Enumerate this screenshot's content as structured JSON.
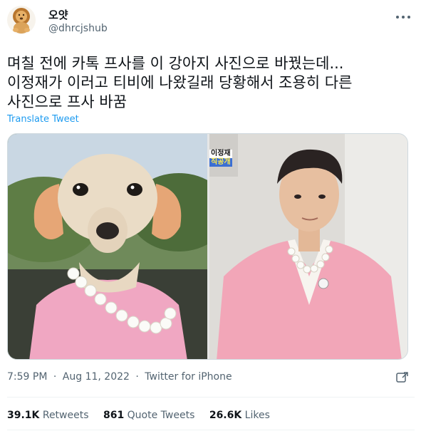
{
  "user": {
    "display_name": "오얏",
    "handle": "@dhrcjshub",
    "avatar_icon": "lion-plush-avatar"
  },
  "tweet": {
    "lines": [
      "며칠 전에 카톡 프사를 이 강아지 사진으로 바꿨는데...",
      "이정재가 이러고 티비에 나왔길래 당황해서 조용히 다른",
      "사진으로 프사 바꿈"
    ],
    "translate_label": "Translate Tweet"
  },
  "media": {
    "right_caption_top": "이정재",
    "right_caption_bottom": "직공개"
  },
  "meta": {
    "time": "7:59 PM",
    "date": "Aug 11, 2022",
    "separator": "·",
    "source": "Twitter for iPhone"
  },
  "stats": {
    "retweets_count": "39.1K",
    "retweets_label": "Retweets",
    "quotes_count": "861",
    "quotes_label": "Quote Tweets",
    "likes_count": "26.6K",
    "likes_label": "Likes"
  },
  "colors": {
    "link": "#1d9bf0",
    "secondary_text": "#536471",
    "primary_text": "#0f1419"
  }
}
